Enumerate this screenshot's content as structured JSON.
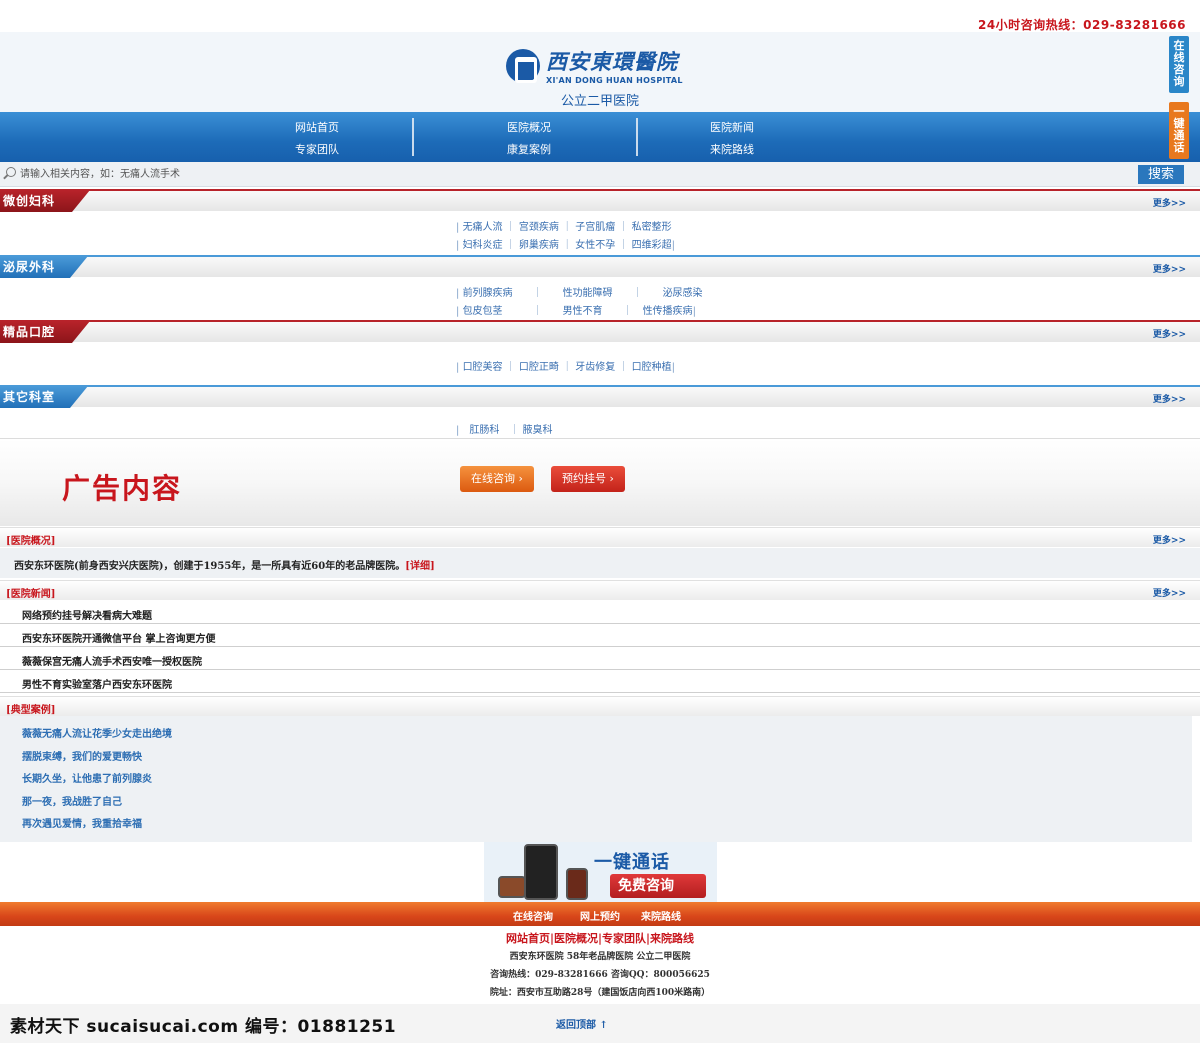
{
  "hotline": "24小时咨询热线：029-83281666",
  "logo": {
    "cn": "西安東環醫院",
    "en": "XI'AN DONG HUAN HOSPITAL",
    "grade": "公立二甲医院"
  },
  "float": {
    "online": "在线咨询",
    "call": "一键通话"
  },
  "nav": {
    "row1": [
      "网站首页",
      "医院概况",
      "医院新闻"
    ],
    "row2": [
      "专家团队",
      "康复案例",
      "来院路线"
    ]
  },
  "search": {
    "placeholder": "请输入相关内容，如：无痛人流手术",
    "button": "搜索"
  },
  "more": "更多>>",
  "sections": [
    {
      "title": "微创妇科",
      "rows": [
        [
          "无痛人流",
          "宫颈疾病",
          "子宫肌瘤",
          "私密整形"
        ],
        [
          "妇科炎症",
          "卵巢疾病",
          "女性不孕",
          "四维彩超"
        ]
      ]
    },
    {
      "title": "泌尿外科",
      "rows": [
        [
          "前列腺疾病",
          "性功能障碍",
          "泌尿感染"
        ],
        [
          "包皮包茎",
          "男性不育",
          "性传播疾病"
        ]
      ]
    },
    {
      "title": "精品口腔",
      "rows": [
        [
          "口腔美容",
          "口腔正畸",
          "牙齿修复",
          "口腔种植"
        ]
      ]
    },
    {
      "title": "其它科室",
      "rows": [
        [
          "肛肠科",
          "腋臭科"
        ]
      ]
    }
  ],
  "ad": {
    "text": "广告内容",
    "btn_online": "在线咨询 ›",
    "btn_register": "预约挂号 ›"
  },
  "overview": {
    "title": "[医院概况]",
    "text": "西安东环医院(前身西安兴庆医院)，创建于1955年，是一所具有近60年的老品牌医院。",
    "detail": "[详细]"
  },
  "news": {
    "title": "[医院新闻]",
    "items": [
      "网络预约挂号解决看病大难题",
      "西安东环医院开通微信平台 掌上咨询更方便",
      "薇薇保宫无痛人流手术西安唯一授权医院",
      "男性不育实验室落户西安东环医院"
    ]
  },
  "cases": {
    "title": "[典型案例]",
    "items": [
      "薇薇无痛人流让花季少女走出绝境",
      "摆脱束缚，我们的爱更畅快",
      "长期久坐，让他患了前列腺炎",
      "那一夜，我战胜了自己",
      "再次遇见爱情，我重拾幸福"
    ]
  },
  "call_banner": {
    "title": "一键通话",
    "button": "免费咨询"
  },
  "footbar": [
    "在线咨询",
    "网上预约",
    "来院路线"
  ],
  "footer": {
    "links": [
      "网站首页",
      "医院概况",
      "专家团队",
      "来院路线"
    ],
    "line1": "西安东环医院    58年老品牌医院  公立二甲医院",
    "line2": "咨询热线：029-83281666   咨询QQ：800056625",
    "line3": "院址：西安市互助路28号（建国饭店向西100米路南）",
    "backtop": "返回顶部 ↑"
  },
  "watermark": "素材天下 sucaisucai.com  编号：01881251",
  "colors": {
    "primary_blue": "#1b5aa6",
    "accent_red": "#c8161d",
    "orange": "#e8781e"
  }
}
